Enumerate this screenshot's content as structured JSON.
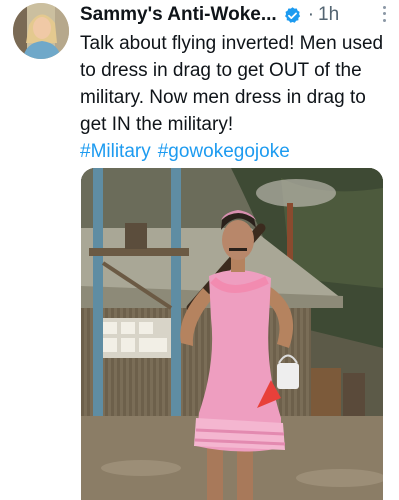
{
  "author": {
    "name": "Sammy's Anti-Woke...",
    "time": "1h",
    "dot": "·",
    "avatar_icon": "user-avatar-photo",
    "verified_icon": "verified-badge-icon",
    "verified_color": "#1d9bf0"
  },
  "tweet": {
    "text": "Talk about flying inverted! Men used to dress in drag to get OUT of the military. Now men dress in drag to get IN the military!",
    "hashtags": [
      "#Military",
      "#gowokegojoke"
    ],
    "hashtag_color": "#1d9bf0"
  },
  "media": {
    "icon": "attached-photo"
  }
}
